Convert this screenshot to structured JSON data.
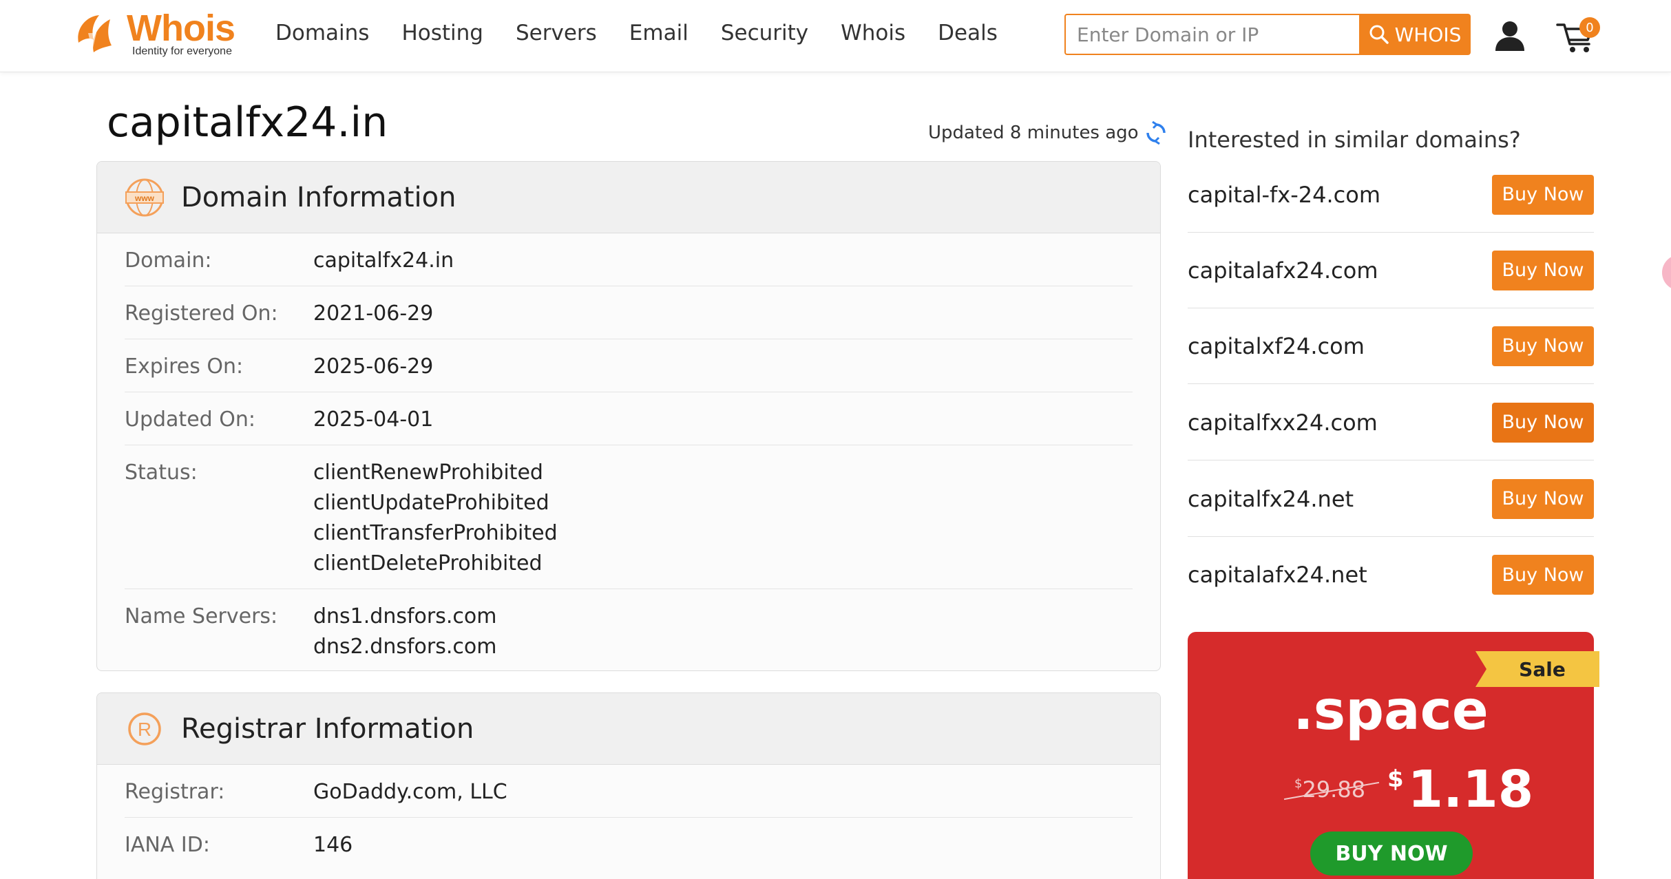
{
  "brand": {
    "name": "Whois",
    "tagline": "Identity for everyone",
    "accent": "#f0821e"
  },
  "nav": {
    "items": [
      "Domains",
      "Hosting",
      "Servers",
      "Email",
      "Security",
      "Whois",
      "Deals"
    ]
  },
  "search": {
    "placeholder": "Enter Domain or IP",
    "button_label": "WHOIS"
  },
  "cart": {
    "count": "0"
  },
  "page": {
    "title": "capitalfx24.in",
    "updated": "Updated 8 minutes ago"
  },
  "domain_info": {
    "title": "Domain Information",
    "icon": "www-icon",
    "rows": [
      {
        "label": "Domain:",
        "values": [
          "capitalfx24.in"
        ]
      },
      {
        "label": "Registered On:",
        "values": [
          "2021-06-29"
        ]
      },
      {
        "label": "Expires On:",
        "values": [
          "2025-06-29"
        ]
      },
      {
        "label": "Updated On:",
        "values": [
          "2025-04-01"
        ]
      },
      {
        "label": "Status:",
        "values": [
          "clientRenewProhibited",
          "clientUpdateProhibited",
          "clientTransferProhibited",
          "clientDeleteProhibited"
        ]
      },
      {
        "label": "Name Servers:",
        "values": [
          "dns1.dnsfors.com",
          "dns2.dnsfors.com"
        ]
      }
    ]
  },
  "registrar_info": {
    "title": "Registrar Information",
    "icon": "registered-icon",
    "rows": [
      {
        "label": "Registrar:",
        "values": [
          "GoDaddy.com, LLC"
        ]
      },
      {
        "label": "IANA ID:",
        "values": [
          "146"
        ]
      }
    ]
  },
  "sidebar": {
    "title": "Interested in similar domains?",
    "buy_label": "Buy Now",
    "suggestions": [
      "capital-fx-24.com",
      "capitalafx24.com",
      "capitalxf24.com",
      "capitalfxx24.com",
      "capitalfx24.net",
      "capitalafx24.net"
    ]
  },
  "promo": {
    "ribbon": "Sale",
    "tld": ".space",
    "old_currency": "$",
    "old_price": "29.88",
    "new_currency": "$",
    "new_price": "1.18",
    "button": "BUY NOW",
    "bg_color": "#d62b2b",
    "button_color": "#1f9a2b"
  }
}
